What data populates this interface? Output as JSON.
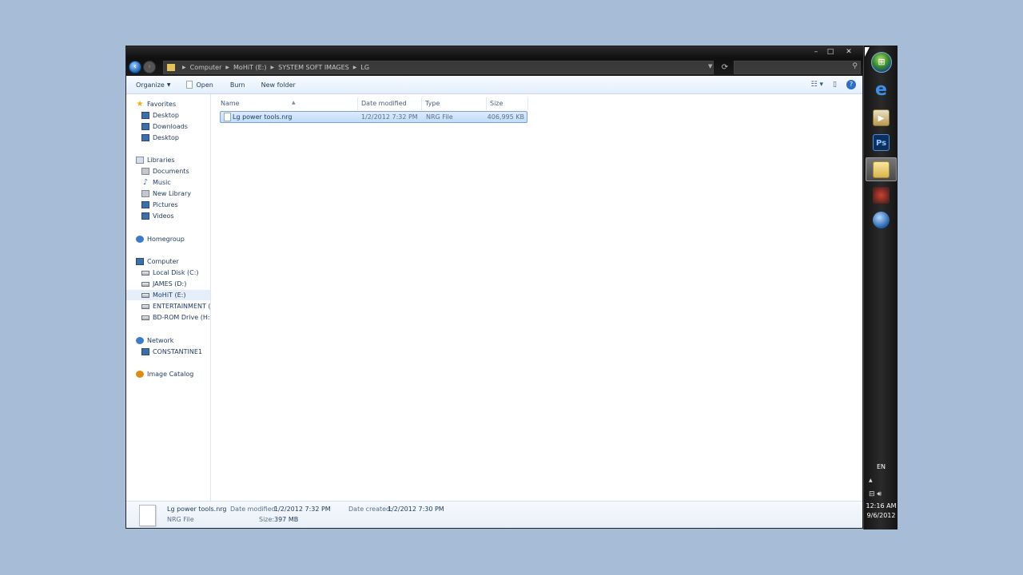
{
  "window": {
    "caption_buttons": {
      "minimize": "–",
      "maximize": "□",
      "close": "✕"
    },
    "address": [
      "Computer",
      "MoHiT (E:)",
      "SYSTEM SOFT IMAGES",
      "LG"
    ],
    "search_placeholder": ""
  },
  "toolbar": {
    "organize": "Organize",
    "open": "Open",
    "burn": "Burn",
    "new_folder": "New folder"
  },
  "sidebar": {
    "favorites": "Favorites",
    "fav_items": [
      "Desktop",
      "Downloads",
      "Desktop"
    ],
    "libraries": "Libraries",
    "lib_items": [
      "Documents",
      "Music",
      "New Library",
      "Pictures",
      "Videos"
    ],
    "homegroup": "Homegroup",
    "computer": "Computer",
    "drives": [
      "Local Disk (C:)",
      "JAMES (D:)",
      "MoHiT (E:)",
      "ENTERTAINMENT (F:)",
      "BD-ROM Drive (H:) S"
    ],
    "network": "Network",
    "network_items": [
      "CONSTANTINE1"
    ],
    "image_catalog": "Image Catalog"
  },
  "columns": {
    "name": "Name",
    "date_modified": "Date modified",
    "type": "Type",
    "size": "Size"
  },
  "files": [
    {
      "name": "Lg power tools.nrg",
      "date_modified": "1/2/2012 7:32 PM",
      "type": "NRG File",
      "size": "406,995 KB"
    }
  ],
  "details": {
    "name": "Lg power tools.nrg",
    "type": "NRG File",
    "date_modified_label": "Date modified:",
    "date_modified": "1/2/2012 7:32 PM",
    "size_label": "Size:",
    "size": "397 MB",
    "date_created_label": "Date created:",
    "date_created": "1/2/2012 7:30 PM"
  },
  "taskbar": {
    "apps": [
      "start-orb",
      "internet-explorer-icon",
      "media-player-icon",
      "photoshop-icon",
      "windows-explorer-icon",
      "game-icon",
      "globe-icon"
    ],
    "ps_label": "Ps",
    "ie_label": "e",
    "language": "EN",
    "time": "12:16 AM",
    "date": "9/6/2012"
  }
}
